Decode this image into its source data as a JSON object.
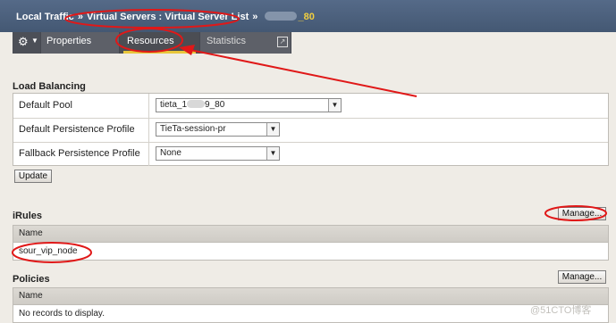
{
  "header": {
    "crumb_1": "Local Traffic",
    "separator_1": "»",
    "crumb_2": "Virtual Servers : Virtual Server List",
    "separator_2": "»",
    "vs_name_suffix": "_80"
  },
  "tabs": {
    "menu_icon": "gear-icon",
    "properties": "Properties",
    "resources": "Resources",
    "statistics": "Statistics",
    "statistics_icon": "external-link-icon"
  },
  "load_balancing": {
    "title": "Load Balancing",
    "rows": [
      {
        "label": "Default Pool",
        "value_prefix": "tieta_1",
        "value_suffix": "9_80"
      },
      {
        "label": "Default Persistence Profile",
        "value": "TieTa-session-pr"
      },
      {
        "label": "Fallback Persistence Profile",
        "value": "None"
      }
    ],
    "update_button": "Update"
  },
  "irules": {
    "title": "iRules",
    "manage_button": "Manage...",
    "column_header": "Name",
    "rows": [
      "sour_vip_node"
    ]
  },
  "policies": {
    "title": "Policies",
    "manage_button": "Manage...",
    "column_header": "Name",
    "empty_text": "No records to display."
  },
  "watermark": "@51CTO博客",
  "colors": {
    "header_bg": "#4d6180",
    "highlight_text": "#f2cf3f",
    "annotation_red": "#e01818",
    "page_bg": "#efece6"
  }
}
